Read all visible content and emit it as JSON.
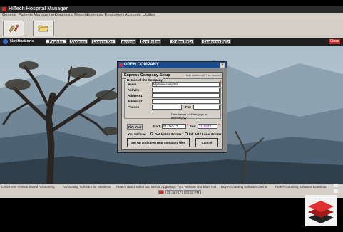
{
  "window": {
    "title": "HiTech Hospital Manager"
  },
  "menu": [
    "General",
    "Patients Management",
    "Diagnostic Reports",
    "Inventory",
    "Employees",
    "Accounts",
    "Utilities"
  ],
  "navbar": {
    "notifications": "Notifications",
    "buttons": [
      "Register",
      "Updates",
      "License Key",
      "Addons",
      "Buy Online",
      "Online Help",
      "Customer Help"
    ],
    "close": "Close"
  },
  "dialog": {
    "title": "OPEN COMPANY",
    "header": "Express Company Setup",
    "required_note": "Fields marked with * are required",
    "group_title": "Details of the Company",
    "fields": {
      "name_label": "Name",
      "name_value": "My New Hospital",
      "activity_label": "Activity",
      "activity_value": "",
      "address1_label": "Address1",
      "address1_value": "",
      "address2_label": "Address2",
      "address2_value": "",
      "phones_label": "Phones",
      "phones_value": "",
      "fax_label": "Fax",
      "fax_value": ""
    },
    "date_format": "Date format : dd/mm/yyyy or mm/dd/yyyy",
    "fin_year_label": "Fin. Year",
    "start_label": "Start",
    "start_value": "01-Jan-17",
    "end_label": "End",
    "end_value": "31/12/17",
    "printer_label": "You will use",
    "printer_options": [
      "Dot Matrix Printer",
      "Ink Jet / Laser Printer"
    ],
    "printer_selected": 0,
    "setup_button": "Set up and open new company files",
    "cancel_button": "Cancel"
  },
  "status_links": [
    "Click Here >>",
    "Web Based Accounting",
    "Accounting Software for Business",
    "Free Android Tablet and Mobile Apps",
    "Design Your Website",
    "Our Blath Net",
    "Buy Accounting Software Online",
    "Free Accounting Software Download"
  ],
  "statusbar": {
    "date": "01-Jan-17",
    "time": "03:33 PM"
  },
  "colors": {
    "titlebar": "#2a2a2a",
    "dialog_title": "#1a4b8a",
    "close_button": "#c0302a",
    "required_star": "#dd0000"
  },
  "icons": [
    "app-icon",
    "edit-icon",
    "folder-icon",
    "bell-icon",
    "close-icon",
    "logo-icon"
  ]
}
